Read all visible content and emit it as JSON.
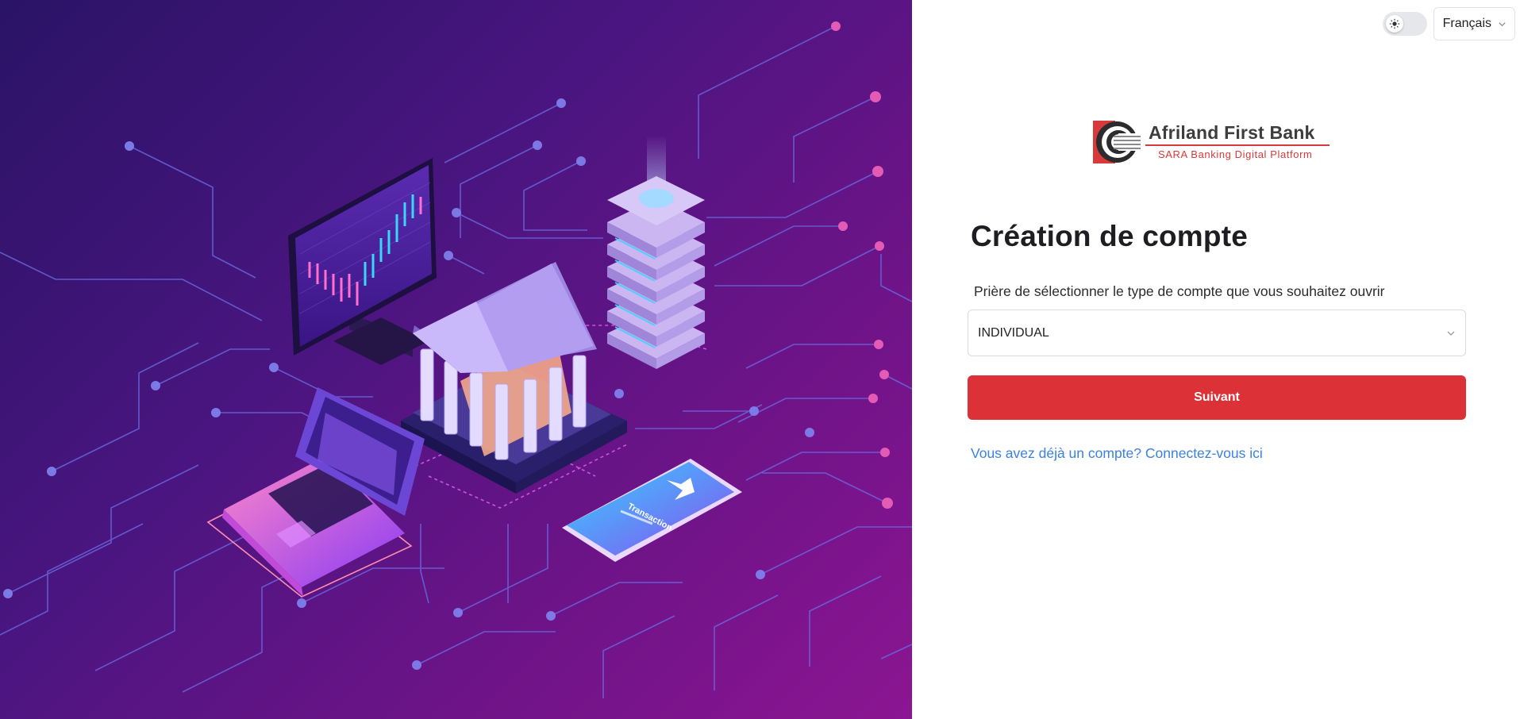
{
  "colors": {
    "primary_red": "#dc3136",
    "link_blue": "#3b82e0",
    "hero_start": "#2a1466",
    "hero_end": "#8c1592"
  },
  "hero": {
    "phone_label": "Transaction",
    "icons": [
      "circuit-background",
      "monitor-chart-illustration",
      "bank-building-illustration",
      "server-stack-illustration",
      "laptop-illustration",
      "phone-transaction-illustration"
    ]
  },
  "header": {
    "theme_toggle_icon": "sun-icon",
    "language_selected": "Français"
  },
  "logo": {
    "title": "Afriland First Bank",
    "subtitle": "SARA Banking Digital Platform"
  },
  "form": {
    "title": "Création de compte",
    "prompt": "Prière de sélectionner le type de compte que vous souhaitez ouvrir",
    "account_type_selected": "INDIVIDUAL",
    "submit_label": "Suivant",
    "login_link": "Vous avez déjà un compte? Connectez-vous ici"
  }
}
